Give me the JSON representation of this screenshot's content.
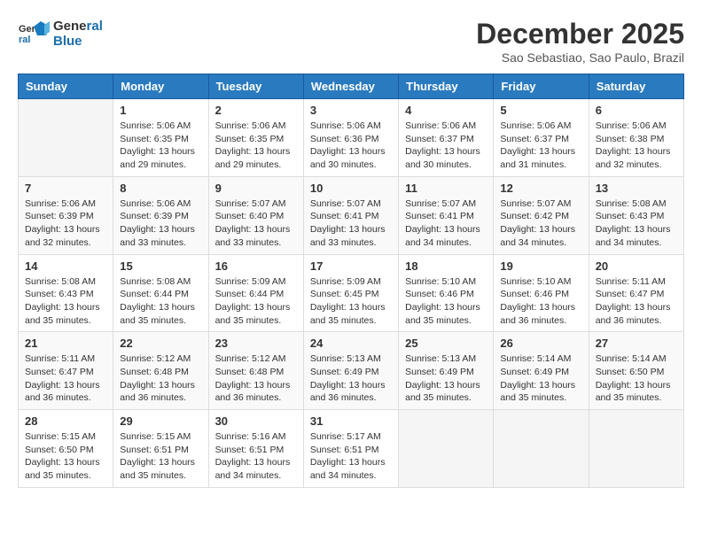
{
  "logo": {
    "line1": "General",
    "line2": "Blue"
  },
  "title": "December 2025",
  "subtitle": "Sao Sebastiao, Sao Paulo, Brazil",
  "days_header": [
    "Sunday",
    "Monday",
    "Tuesday",
    "Wednesday",
    "Thursday",
    "Friday",
    "Saturday"
  ],
  "weeks": [
    [
      {
        "day": "",
        "info": ""
      },
      {
        "day": "1",
        "info": "Sunrise: 5:06 AM\nSunset: 6:35 PM\nDaylight: 13 hours\nand 29 minutes."
      },
      {
        "day": "2",
        "info": "Sunrise: 5:06 AM\nSunset: 6:35 PM\nDaylight: 13 hours\nand 29 minutes."
      },
      {
        "day": "3",
        "info": "Sunrise: 5:06 AM\nSunset: 6:36 PM\nDaylight: 13 hours\nand 30 minutes."
      },
      {
        "day": "4",
        "info": "Sunrise: 5:06 AM\nSunset: 6:37 PM\nDaylight: 13 hours\nand 30 minutes."
      },
      {
        "day": "5",
        "info": "Sunrise: 5:06 AM\nSunset: 6:37 PM\nDaylight: 13 hours\nand 31 minutes."
      },
      {
        "day": "6",
        "info": "Sunrise: 5:06 AM\nSunset: 6:38 PM\nDaylight: 13 hours\nand 32 minutes."
      }
    ],
    [
      {
        "day": "7",
        "info": "Sunrise: 5:06 AM\nSunset: 6:39 PM\nDaylight: 13 hours\nand 32 minutes."
      },
      {
        "day": "8",
        "info": "Sunrise: 5:06 AM\nSunset: 6:39 PM\nDaylight: 13 hours\nand 33 minutes."
      },
      {
        "day": "9",
        "info": "Sunrise: 5:07 AM\nSunset: 6:40 PM\nDaylight: 13 hours\nand 33 minutes."
      },
      {
        "day": "10",
        "info": "Sunrise: 5:07 AM\nSunset: 6:41 PM\nDaylight: 13 hours\nand 33 minutes."
      },
      {
        "day": "11",
        "info": "Sunrise: 5:07 AM\nSunset: 6:41 PM\nDaylight: 13 hours\nand 34 minutes."
      },
      {
        "day": "12",
        "info": "Sunrise: 5:07 AM\nSunset: 6:42 PM\nDaylight: 13 hours\nand 34 minutes."
      },
      {
        "day": "13",
        "info": "Sunrise: 5:08 AM\nSunset: 6:43 PM\nDaylight: 13 hours\nand 34 minutes."
      }
    ],
    [
      {
        "day": "14",
        "info": "Sunrise: 5:08 AM\nSunset: 6:43 PM\nDaylight: 13 hours\nand 35 minutes."
      },
      {
        "day": "15",
        "info": "Sunrise: 5:08 AM\nSunset: 6:44 PM\nDaylight: 13 hours\nand 35 minutes."
      },
      {
        "day": "16",
        "info": "Sunrise: 5:09 AM\nSunset: 6:44 PM\nDaylight: 13 hours\nand 35 minutes."
      },
      {
        "day": "17",
        "info": "Sunrise: 5:09 AM\nSunset: 6:45 PM\nDaylight: 13 hours\nand 35 minutes."
      },
      {
        "day": "18",
        "info": "Sunrise: 5:10 AM\nSunset: 6:46 PM\nDaylight: 13 hours\nand 35 minutes."
      },
      {
        "day": "19",
        "info": "Sunrise: 5:10 AM\nSunset: 6:46 PM\nDaylight: 13 hours\nand 36 minutes."
      },
      {
        "day": "20",
        "info": "Sunrise: 5:11 AM\nSunset: 6:47 PM\nDaylight: 13 hours\nand 36 minutes."
      }
    ],
    [
      {
        "day": "21",
        "info": "Sunrise: 5:11 AM\nSunset: 6:47 PM\nDaylight: 13 hours\nand 36 minutes."
      },
      {
        "day": "22",
        "info": "Sunrise: 5:12 AM\nSunset: 6:48 PM\nDaylight: 13 hours\nand 36 minutes."
      },
      {
        "day": "23",
        "info": "Sunrise: 5:12 AM\nSunset: 6:48 PM\nDaylight: 13 hours\nand 36 minutes."
      },
      {
        "day": "24",
        "info": "Sunrise: 5:13 AM\nSunset: 6:49 PM\nDaylight: 13 hours\nand 36 minutes."
      },
      {
        "day": "25",
        "info": "Sunrise: 5:13 AM\nSunset: 6:49 PM\nDaylight: 13 hours\nand 35 minutes."
      },
      {
        "day": "26",
        "info": "Sunrise: 5:14 AM\nSunset: 6:49 PM\nDaylight: 13 hours\nand 35 minutes."
      },
      {
        "day": "27",
        "info": "Sunrise: 5:14 AM\nSunset: 6:50 PM\nDaylight: 13 hours\nand 35 minutes."
      }
    ],
    [
      {
        "day": "28",
        "info": "Sunrise: 5:15 AM\nSunset: 6:50 PM\nDaylight: 13 hours\nand 35 minutes."
      },
      {
        "day": "29",
        "info": "Sunrise: 5:15 AM\nSunset: 6:51 PM\nDaylight: 13 hours\nand 35 minutes."
      },
      {
        "day": "30",
        "info": "Sunrise: 5:16 AM\nSunset: 6:51 PM\nDaylight: 13 hours\nand 34 minutes."
      },
      {
        "day": "31",
        "info": "Sunrise: 5:17 AM\nSunset: 6:51 PM\nDaylight: 13 hours\nand 34 minutes."
      },
      {
        "day": "",
        "info": ""
      },
      {
        "day": "",
        "info": ""
      },
      {
        "day": "",
        "info": ""
      }
    ]
  ]
}
